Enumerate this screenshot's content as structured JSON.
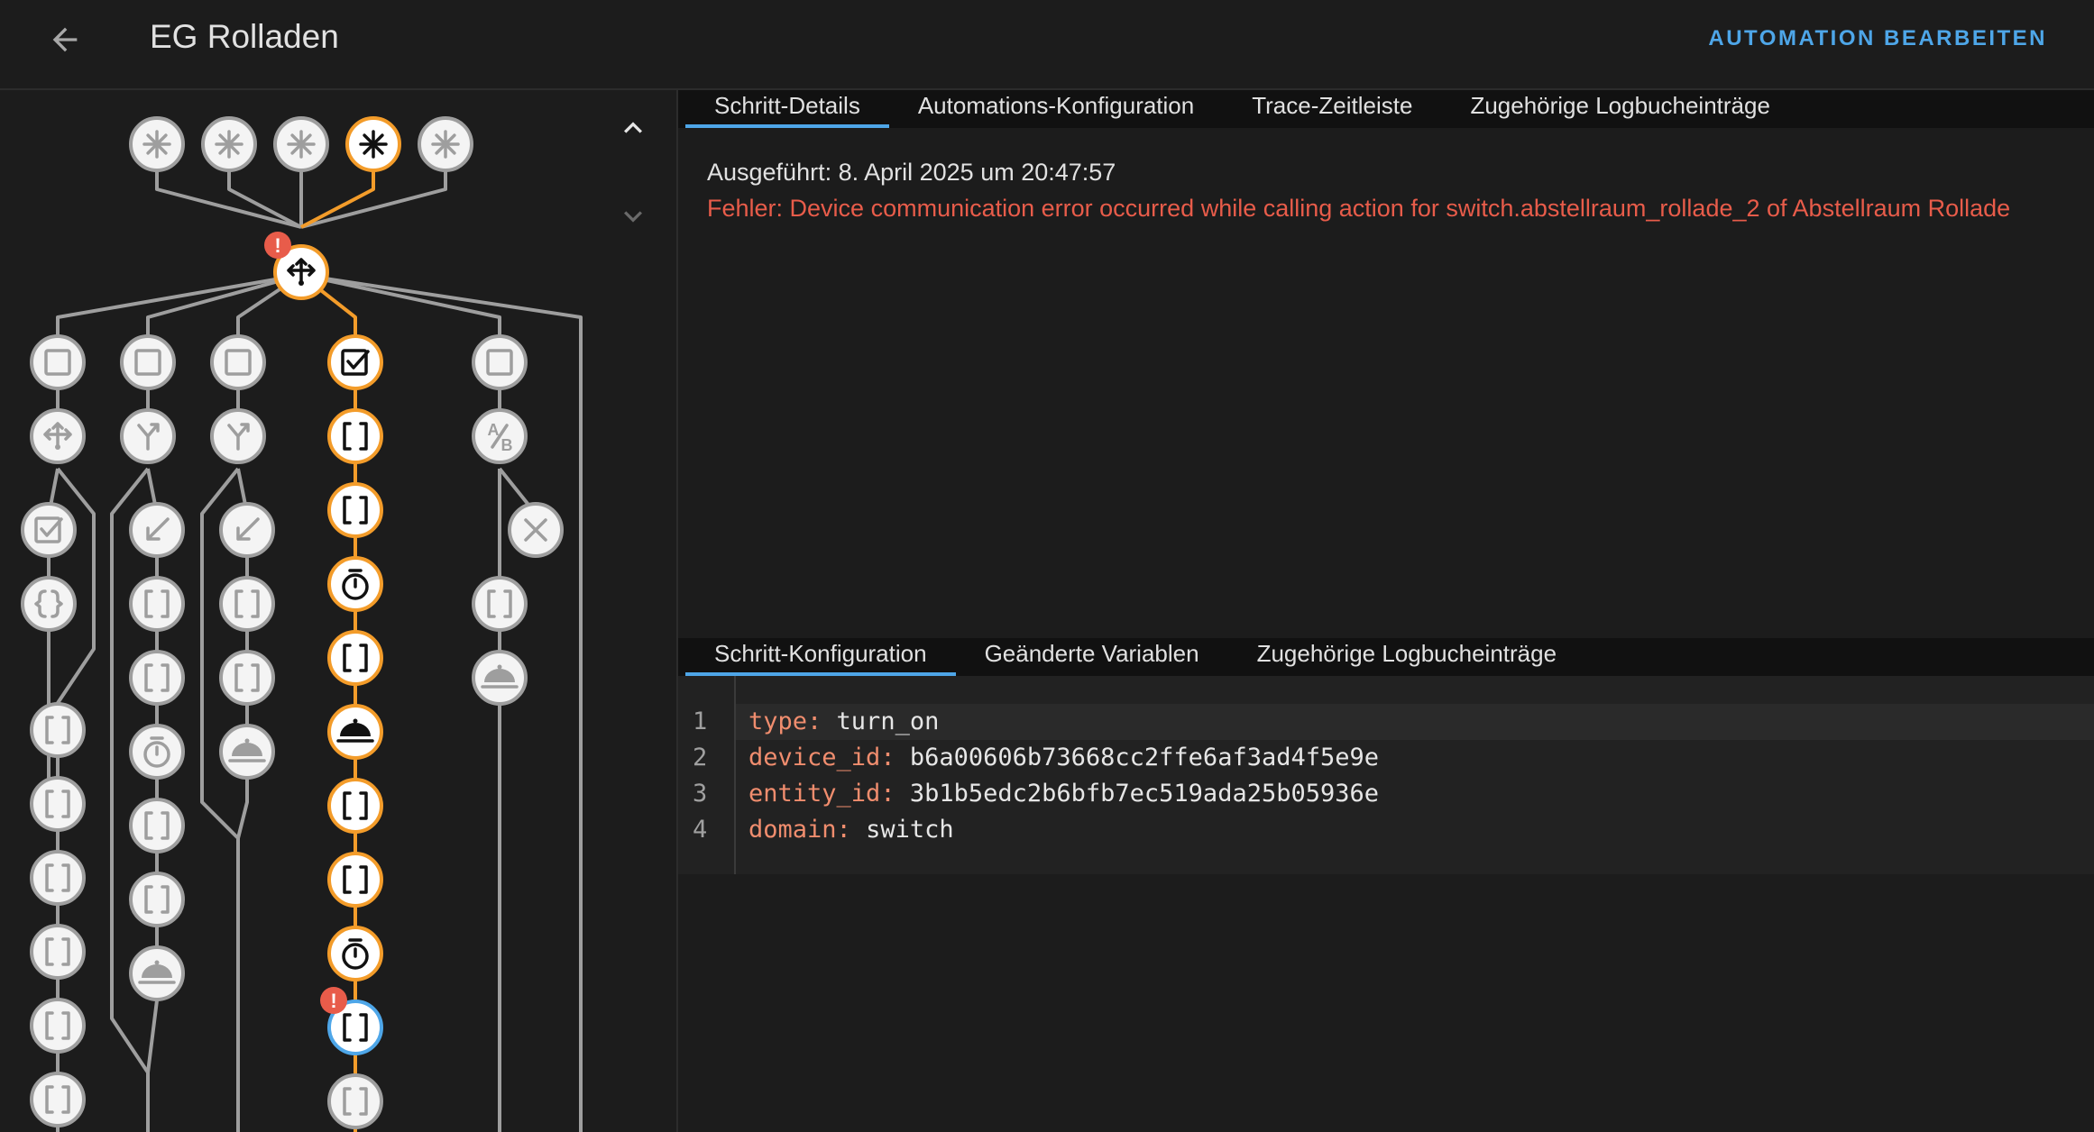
{
  "header": {
    "title": "EG Rolladen",
    "edit_label": "AUTOMATION BEARBEITEN",
    "accent": "#4ea6e8"
  },
  "top_tabs": [
    {
      "label": "Schritt-Details",
      "active": true
    },
    {
      "label": "Automations-Konfiguration",
      "active": false
    },
    {
      "label": "Trace-Zeitleiste",
      "active": false
    },
    {
      "label": "Zugehörige Logbucheinträge",
      "active": false
    }
  ],
  "details": {
    "executed": "Ausgeführt: 8. April 2025 um 20:47:57",
    "error": "Fehler: Device communication error occurred while calling action for switch.abstellraum_rollade_2 of Abstellraum Rollade"
  },
  "bottom_tabs": [
    {
      "label": "Schritt-Konfiguration",
      "active": true
    },
    {
      "label": "Geänderte Variablen",
      "active": false
    },
    {
      "label": "Zugehörige Logbucheinträge",
      "active": false
    }
  ],
  "config_lines": [
    {
      "num": "1",
      "key": "type",
      "value": "turn_on"
    },
    {
      "num": "2",
      "key": "device_id",
      "value": "b6a00606b73668cc2ffe6af3ad4f5e9e"
    },
    {
      "num": "3",
      "key": "entity_id",
      "value": "3b1b5edc2b6bfb7ec519ada25b05936e"
    },
    {
      "num": "4",
      "key": "domain",
      "value": "switch"
    }
  ],
  "colors": {
    "active_path": "#f39c2a",
    "selected_node": "#4ea6e8",
    "error": "#e85c4a",
    "inactive_path": "#9e9e9e"
  },
  "graph": {
    "trigger_icons": [
      "trigger-icon",
      "trigger-icon",
      "trigger-icon",
      "trigger-icon",
      "trigger-icon"
    ],
    "root_icon": "choose-icon",
    "column_active_icons": [
      "condition-checked-icon",
      "action-icon",
      "action-icon",
      "delay-icon",
      "action-icon",
      "service-icon",
      "action-icon",
      "action-icon",
      "delay-icon",
      "action-icon",
      "action-icon"
    ]
  }
}
